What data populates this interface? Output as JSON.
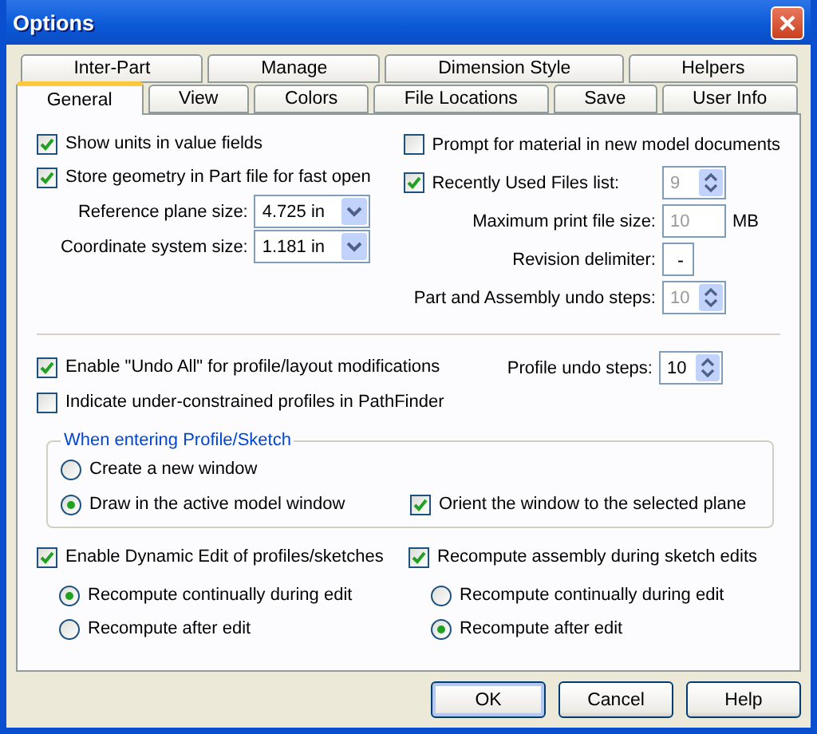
{
  "window": {
    "title": "Options"
  },
  "tabs": {
    "back_row": [
      {
        "label": "Inter-Part",
        "selected": false
      },
      {
        "label": "Manage",
        "selected": false
      },
      {
        "label": "Dimension Style",
        "selected": false
      },
      {
        "label": "Helpers",
        "selected": false
      }
    ],
    "front_row": [
      {
        "label": "General",
        "selected": true
      },
      {
        "label": "View",
        "selected": false
      },
      {
        "label": "Colors",
        "selected": false
      },
      {
        "label": "File Locations",
        "selected": false
      },
      {
        "label": "Save",
        "selected": false
      },
      {
        "label": "User Info",
        "selected": false
      }
    ]
  },
  "left_options": [
    {
      "kind": "checkbox",
      "label": "Show units in value fields",
      "checked": true
    },
    {
      "kind": "checkbox",
      "label": "Store geometry in Part file for fast open",
      "checked": true
    },
    {
      "kind": "dropdown",
      "label": "Reference plane size:",
      "value": "4.725 in"
    },
    {
      "kind": "dropdown",
      "label": "Coordinate system size:",
      "value": "1.181 in"
    }
  ],
  "right_options": [
    {
      "kind": "checkbox",
      "label": "Prompt for material in new model documents",
      "checked": false
    },
    {
      "kind": "checkbox_spinner",
      "label": "Recently Used Files list:",
      "checked": true,
      "value": "9",
      "disabled": true
    },
    {
      "kind": "text",
      "label": "Maximum print file size:",
      "value": "10",
      "unit": "MB",
      "disabled": true
    },
    {
      "kind": "text",
      "label": "Revision delimiter:",
      "value": "-",
      "disabled": false
    },
    {
      "kind": "spinner",
      "label": "Part and Assembly undo steps:",
      "value": "10",
      "disabled": true
    }
  ],
  "undo": {
    "undo_all": {
      "label": "Enable \"Undo All\" for profile/layout modifications",
      "checked": true
    },
    "profile_steps": {
      "label": "Profile undo steps:",
      "value": "10",
      "disabled": false
    },
    "indicate": {
      "label": "Indicate under-constrained profiles in PathFinder",
      "checked": false
    }
  },
  "entering_group": {
    "title": "When entering Profile/Sketch",
    "radios": [
      {
        "label": "Create a new window",
        "selected": false
      },
      {
        "label": "Draw in the active model window",
        "selected": true
      }
    ],
    "orient": {
      "label": "Orient the window to the selected plane",
      "checked": true
    }
  },
  "recompute": [
    {
      "label": "Enable Dynamic Edit of profiles/sketches",
      "checked": true,
      "radios": [
        {
          "label": "Recompute continually during edit",
          "selected": true
        },
        {
          "label": "Recompute after edit",
          "selected": false
        }
      ]
    },
    {
      "label": "Recompute assembly during sketch edits",
      "checked": true,
      "radios": [
        {
          "label": "Recompute continually during edit",
          "selected": false
        },
        {
          "label": "Recompute after edit",
          "selected": true
        }
      ]
    }
  ],
  "buttons": [
    {
      "label": "OK",
      "default": true
    },
    {
      "label": "Cancel",
      "default": false
    },
    {
      "label": "Help",
      "default": false
    }
  ]
}
